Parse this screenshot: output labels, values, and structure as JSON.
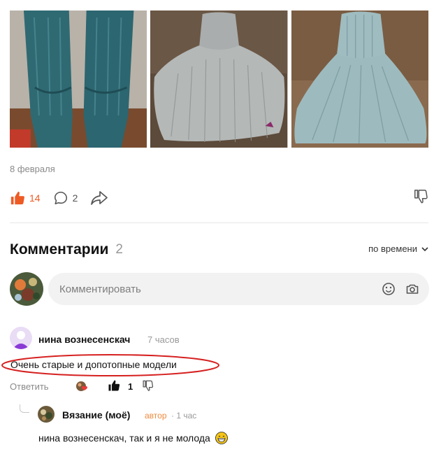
{
  "post": {
    "date": "8 февраля",
    "likes": "14",
    "comments": "2"
  },
  "comments_section": {
    "title": "Комментарии",
    "count": "2",
    "sort_label": "по времени",
    "input_placeholder": "Комментировать"
  },
  "comments": [
    {
      "author": "нина вознесенскач",
      "time": "7 часов",
      "text": "Очень старые и допотопные модели",
      "reply_label": "Ответить",
      "likes": "1"
    }
  ],
  "replies": [
    {
      "author": "Вязание (моё)",
      "badge": "автор",
      "time": "· 1 час",
      "text": "нина вознесенскач, так и я не молода"
    }
  ],
  "colors": {
    "accent": "#ee5a24",
    "author_badge": "#ee8a3e",
    "highlight_oval": "#d62020"
  }
}
